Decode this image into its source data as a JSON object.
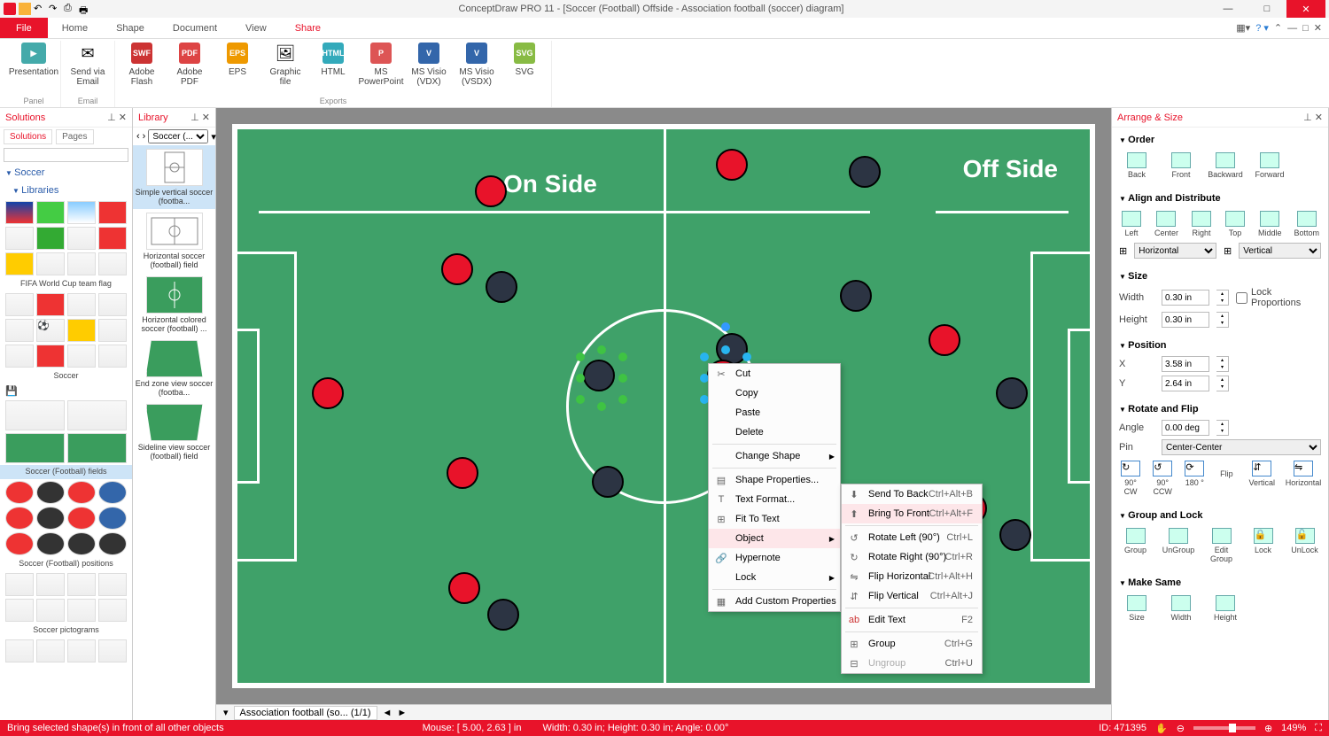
{
  "titlebar": {
    "title": "ConceptDraw PRO 11 - [Soccer (Football) Offside - Association football (soccer) diagram]"
  },
  "menu": {
    "file": "File",
    "home": "Home",
    "shape": "Shape",
    "document": "Document",
    "view": "View",
    "share": "Share"
  },
  "ribbon": {
    "panel_group": "Panel",
    "email_group": "Email",
    "exports_group": "Exports",
    "presentation": "Presentation",
    "sendvia": "Send via Email",
    "flash": "Adobe Flash",
    "pdf": "Adobe PDF",
    "eps": "EPS",
    "graphic": "Graphic file",
    "html": "HTML",
    "ppt": "MS PowerPoint",
    "vdx": "MS Visio (VDX)",
    "vsdx": "MS Visio (VSDX)",
    "svg": "SVG"
  },
  "solutions": {
    "title": "Solutions",
    "tabs": {
      "solutions": "Solutions",
      "pages": "Pages"
    },
    "soccer": "Soccer",
    "libraries": "Libraries",
    "lib1": "FIFA World Cup team flag",
    "lib2": "Soccer",
    "lib3": "Soccer (Football) fields",
    "lib4": "Soccer (Football) positions",
    "lib5": "Soccer pictograms"
  },
  "library": {
    "title": "Library",
    "combo": "Soccer (...",
    "s1": "Simple vertical soccer (footba...",
    "s2": "Horizontal soccer (football) field",
    "s3": "Horizontal colored soccer (football) ...",
    "s4": "End zone view soccer (footba...",
    "s5": "Sideline view soccer (football) field"
  },
  "canvas": {
    "onside": "On Side",
    "offside": "Off Side"
  },
  "ctx1": {
    "cut": "Cut",
    "copy": "Copy",
    "paste": "Paste",
    "delete": "Delete",
    "change": "Change Shape",
    "props": "Shape Properties...",
    "textfmt": "Text Format...",
    "fit": "Fit To Text",
    "object": "Object",
    "hypernote": "Hypernote",
    "lock": "Lock",
    "custom": "Add Custom Properties"
  },
  "ctx2": {
    "sendback": "Send To Back",
    "sendback_sc": "Ctrl+Alt+B",
    "bringfront": "Bring To Front",
    "bringfront_sc": "Ctrl+Alt+F",
    "rotleft": "Rotate Left (90°)",
    "rotleft_sc": "Ctrl+L",
    "rotright": "Rotate Right (90°)",
    "rotright_sc": "Ctrl+R",
    "fliph": "Flip Horizontal",
    "fliph_sc": "Ctrl+Alt+H",
    "flipv": "Flip Vertical",
    "flipv_sc": "Ctrl+Alt+J",
    "edittext": "Edit Text",
    "edittext_sc": "F2",
    "group": "Group",
    "group_sc": "Ctrl+G",
    "ungroup": "Ungroup",
    "ungroup_sc": "Ctrl+U"
  },
  "arrange": {
    "title": "Arrange & Size",
    "order": "Order",
    "back": "Back",
    "front": "Front",
    "backward": "Backward",
    "forward": "Forward",
    "align": "Align and Distribute",
    "left": "Left",
    "center": "Center",
    "right": "Right",
    "top": "Top",
    "middle": "Middle",
    "bottom": "Bottom",
    "horiz": "Horizontal",
    "vert": "Vertical",
    "size": "Size",
    "width": "Width",
    "height": "Height",
    "wv": "0.30 in",
    "hv": "0.30 in",
    "lockprop": "Lock Proportions",
    "position": "Position",
    "x": "X",
    "y": "Y",
    "xv": "3.58 in",
    "yv": "2.64 in",
    "rotate": "Rotate and Flip",
    "angle": "Angle",
    "anglev": "0.00 deg",
    "pin": "Pin",
    "pinv": "Center-Center",
    "r90cw": "90° CW",
    "r90ccw": "90° CCW",
    "r180": "180 °",
    "flip": "Flip",
    "flv": "Vertical",
    "flh": "Horizontal",
    "grouplock": "Group and Lock",
    "grp": "Group",
    "ungrp": "UnGroup",
    "editgrp": "Edit Group",
    "lck": "Lock",
    "unlck": "UnLock",
    "makesame": "Make Same",
    "mssize": "Size",
    "mswidth": "Width",
    "msheight": "Height"
  },
  "doctab": {
    "name": "Association football (so...",
    "pages": "(1/1)"
  },
  "status": {
    "hint": "Bring selected shape(s) in front of all other objects",
    "mouse": "Mouse: [ 5.00, 2.63 ] in",
    "dims": "Width: 0.30 in;  Height: 0.30 in;  Angle: 0.00°",
    "id": "ID: 471395",
    "zoom": "149%"
  }
}
